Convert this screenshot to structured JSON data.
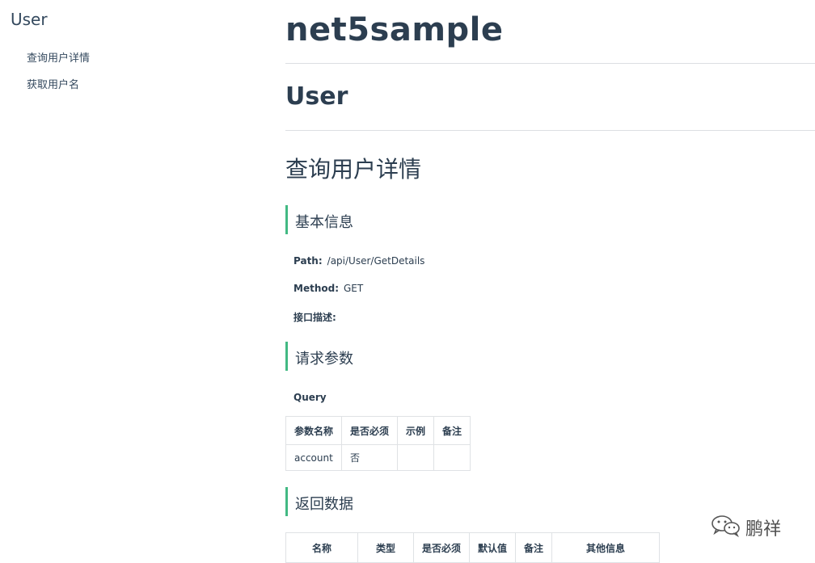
{
  "sidebar": {
    "title": "User",
    "items": [
      {
        "label": "查询用户详情"
      },
      {
        "label": "获取用户名"
      }
    ]
  },
  "main": {
    "project_title": "net5sample",
    "controller_title": "User",
    "endpoint_title": "查询用户详情",
    "basic_info": {
      "heading": "基本信息",
      "path_label": "Path:",
      "path_value": "/api/User/GetDetails",
      "method_label": "Method:",
      "method_value": "GET",
      "desc_label": "接口描述:",
      "desc_value": ""
    },
    "request_params": {
      "heading": "请求参数",
      "query_label": "Query",
      "columns": [
        "参数名称",
        "是否必须",
        "示例",
        "备注"
      ],
      "rows": [
        [
          "account",
          "否",
          "",
          ""
        ]
      ]
    },
    "response": {
      "heading": "返回数据",
      "columns": [
        "名称",
        "类型",
        "是否必须",
        "默认值",
        "备注",
        "其他信息"
      ]
    }
  },
  "watermark": {
    "icon": "wechat-icon",
    "text": "鹏祥"
  }
}
